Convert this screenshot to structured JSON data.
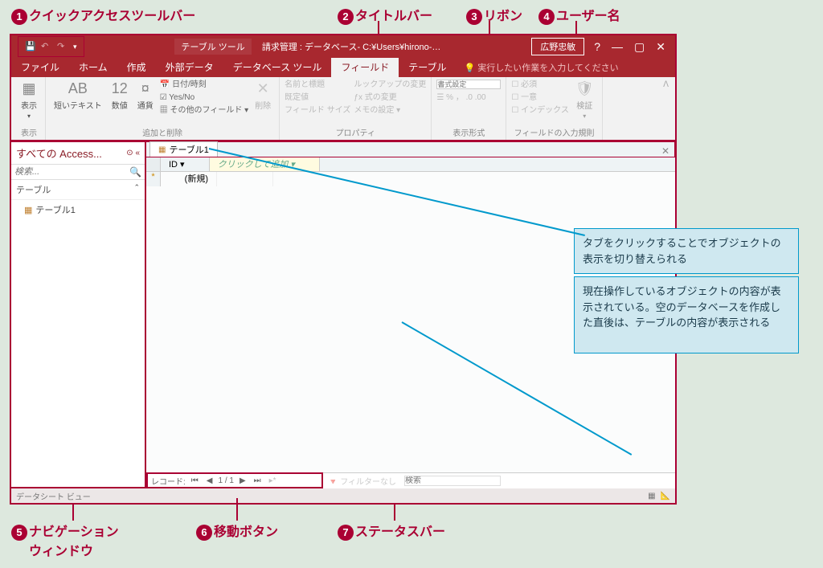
{
  "callouts": {
    "c1": "クイックアクセスツールバー",
    "c2": "タイトルバー",
    "c3": "リボン",
    "c4": "ユーザー名",
    "c5a": "ナビゲーション",
    "c5b": "ウィンドウ",
    "c6": "移動ボタン",
    "c7": "ステータスバー"
  },
  "info": {
    "box1": "タブをクリックすることでオブジェクトの表示を切り替えられる",
    "box2": "現在操作しているオブジェクトの内容が表示されている。空のデータベースを作成した直後は、テーブルの内容が表示される"
  },
  "title": {
    "tools": "テーブル ツール",
    "text": "請求管理 : データベース- C:¥Users¥hirono-…",
    "user": "広野忠敏"
  },
  "menutabs": {
    "file": "ファイル",
    "home": "ホーム",
    "create": "作成",
    "extern": "外部データ",
    "dbtools": "データベース ツール",
    "fields": "フィールド",
    "table": "テーブル",
    "tell": "実行したい作業を入力してください"
  },
  "ribbon": {
    "g_view": "表示",
    "g_addrem": "追加と削除",
    "g_prop": "プロパティ",
    "g_fmt": "表示形式",
    "g_valid": "フィールドの入力規則",
    "btn_view": "表示",
    "btn_short": "短いテキスト",
    "btn_num": "数値",
    "btn_cur": "通貨",
    "btn_AB": "AB",
    "btn_12": "12",
    "opt_datetime": "日付/時刻",
    "opt_yesno": "Yes/No",
    "opt_more": "その他のフィールド ▾",
    "btn_del": "削除",
    "p_name": "名前と標題",
    "p_default": "既定値",
    "p_size": "フィールド サイズ",
    "p_lookup": "ルックアップの変更",
    "p_expr": "式の変更",
    "p_memo": "メモの設定 ▾",
    "fmt_label": "書式設定",
    "v_req": "必須",
    "v_uni": "一意",
    "v_idx": "インデックス",
    "btn_valid": "検証"
  },
  "nav": {
    "header": "すべての Access...",
    "search_ph": "検索...",
    "cat_table": "テーブル",
    "item1": "テーブル1"
  },
  "sheet": {
    "tabname": "テーブル1",
    "col_id": "ID",
    "col_add": "クリックして追加",
    "row_new": "(新規)"
  },
  "recnav": {
    "label": "レコード:",
    "pos": "1 / 1",
    "filter": "フィルターなし",
    "search": "検索"
  },
  "status": {
    "view": "データシート ビュー"
  }
}
